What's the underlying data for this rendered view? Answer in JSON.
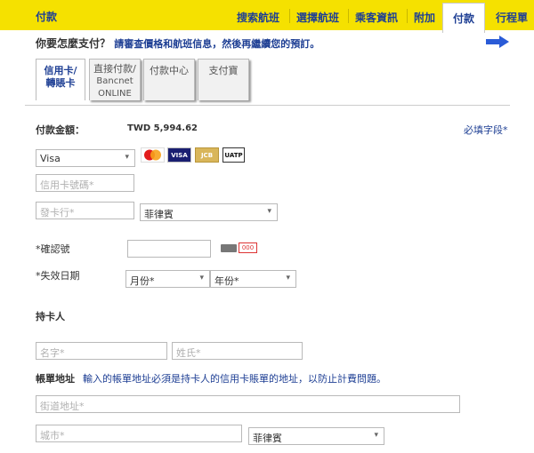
{
  "header": {
    "title": "付款",
    "nav": [
      {
        "label": "搜索航班"
      },
      {
        "label": "選擇航班"
      },
      {
        "label": "乘客資訊"
      },
      {
        "label": "附加"
      },
      {
        "label": "付款"
      },
      {
        "label": "行程單"
      }
    ]
  },
  "payment": {
    "question": "你要怎麼支付？",
    "question_hint": "請審查價格和航班信息，然後再繼續您的預訂。",
    "tabs": [
      {
        "line1": "信用卡/",
        "line2": "轉賬卡"
      },
      {
        "line1": "直接付款/",
        "line2": "Bancnet",
        "line3": "ONLINE"
      },
      {
        "line1": "付款中心"
      },
      {
        "line1": "支付寶"
      }
    ],
    "amount_label": "付款金額：",
    "amount_value": "TWD 5,994.62",
    "required_fields": "必填字段*",
    "card_type_value": "Visa",
    "card_brands": [
      "MasterCard",
      "VISA",
      "JCB",
      "UATP"
    ],
    "card_number_placeholder": "信用卡號碼*",
    "issuer_placeholder": "發卡行*",
    "issuer_country_value": "菲律賓",
    "cvv_label": "*確認號",
    "cvv_icon_text": "000",
    "expiry_label": "*失效日期",
    "month_value": "月份*",
    "year_value": "年份*",
    "cardholder_label": "持卡人",
    "first_name_placeholder": "名字*",
    "last_name_placeholder": "姓氏*",
    "billing_label": "帳單地址",
    "billing_note": "輸入的帳單地址必須是持卡人的信用卡賬單的地址，以防止計費問題。",
    "street_placeholder": "街道地址*",
    "city_placeholder": "城市*",
    "country_value": "菲律賓"
  },
  "colors": {
    "accent_yellow": "#f5e100",
    "link_blue": "#1e3f94",
    "arrow_blue": "#2a5bd7"
  }
}
